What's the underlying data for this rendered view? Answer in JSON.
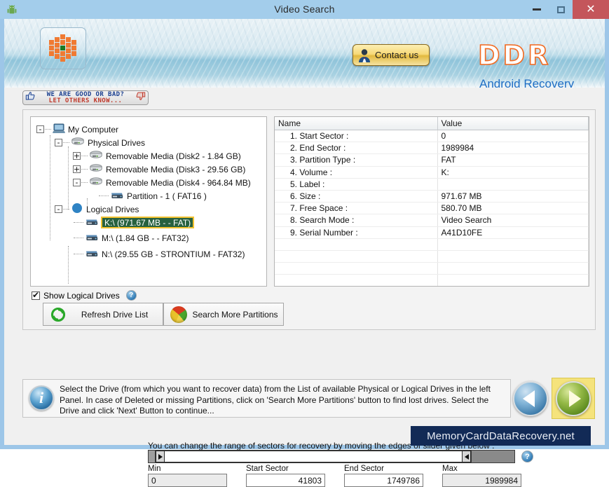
{
  "window": {
    "title": "Video Search",
    "icon": "android-robot-icon",
    "buttons": {
      "minimize": "minimize",
      "maximize": "maximize",
      "close": "✕"
    }
  },
  "header": {
    "app_icon": "checkered-flower-icon",
    "contact_label": "Contact us",
    "contact_icon": "person-avatar-icon",
    "brand": "DDR",
    "brand_sub": "Android Recovery",
    "brand_color": "#f26a21",
    "brand_sub_color": "#1f6ec4"
  },
  "review_ribbon": {
    "line1": "WE ARE GOOD OR BAD?",
    "line2": "LET OTHERS KNOW...",
    "thumb_up_icon": "thumbs-up-icon",
    "thumb_down_icon": "thumbs-down-icon",
    "line1_color": "#1a3f8f",
    "line2_color": "#c0392b"
  },
  "tree": {
    "nodes": [
      {
        "label": "My Computer",
        "indent": 0,
        "toggle": "-",
        "icon": "computer-icon"
      },
      {
        "label": "Physical Drives",
        "indent": 1,
        "toggle": "-",
        "icon": "disk-stack-icon"
      },
      {
        "label": "Removable Media (Disk2 - 1.84 GB)",
        "indent": 2,
        "toggle": "+",
        "icon": "disk-stack-icon"
      },
      {
        "label": "Removable Media (Disk3 - 29.56 GB)",
        "indent": 2,
        "toggle": "+",
        "icon": "disk-stack-icon"
      },
      {
        "label": "Removable Media (Disk4 - 964.84 MB)",
        "indent": 2,
        "toggle": "-",
        "icon": "disk-stack-icon"
      },
      {
        "label": "Partition - 1 ( FAT16 )",
        "indent": 3,
        "toggle": "",
        "icon": "drive-icon"
      },
      {
        "label": "Logical Drives",
        "indent": 1,
        "toggle": "-",
        "icon": "logical-drives-icon"
      },
      {
        "label": "K:\\ (971.67 MB -  - FAT)",
        "indent": 2,
        "toggle": "",
        "icon": "drive-icon",
        "selected": true
      },
      {
        "label": "M:\\ (1.84 GB -  - FAT32)",
        "indent": 2,
        "toggle": "",
        "icon": "drive-icon"
      },
      {
        "label": "N:\\ (29.55 GB - STRONTIUM - FAT32)",
        "indent": 2,
        "toggle": "",
        "icon": "drive-icon"
      }
    ],
    "selection_bg": "#27613f",
    "selection_border": "#f2c230"
  },
  "details_table": {
    "columns": [
      "Name",
      "Value"
    ],
    "rows": [
      {
        "name": "1. Start Sector :",
        "value": "0"
      },
      {
        "name": "2. End Sector :",
        "value": "1989984"
      },
      {
        "name": "3. Partition Type :",
        "value": "FAT"
      },
      {
        "name": "4. Volume :",
        "value": "K:"
      },
      {
        "name": "5. Label :",
        "value": ""
      },
      {
        "name": "6. Size :",
        "value": "971.67 MB"
      },
      {
        "name": "7. Free Space :",
        "value": "580.70 MB"
      },
      {
        "name": "8. Search Mode :",
        "value": "Video Search"
      },
      {
        "name": "9. Serial Number :",
        "value": "A41D10FE"
      },
      {
        "name": "",
        "value": ""
      },
      {
        "name": "",
        "value": ""
      },
      {
        "name": "",
        "value": ""
      },
      {
        "name": "",
        "value": ""
      }
    ]
  },
  "controls": {
    "show_logical_drives": "Show Logical Drives",
    "show_logical_checked": true,
    "help_glyph": "?",
    "refresh_label": "Refresh Drive List",
    "refresh_icon": "refresh-circular-arrows-icon",
    "search_partitions_label": "Search More Partitions",
    "search_partitions_icon": "pie-chart-icon"
  },
  "slider": {
    "hint": "You can change the range of sectors for recovery by moving the edges of slider given below :",
    "left_handle_icon": "slider-handle-right-arrow",
    "right_handle_icon": "slider-handle-left-arrow",
    "help_glyph": "?",
    "fields": [
      {
        "label": "Min",
        "value": "0"
      },
      {
        "label": "Start Sector",
        "value": "41803"
      },
      {
        "label": "End Sector",
        "value": "1749786"
      },
      {
        "label": "Max",
        "value": "1989984"
      }
    ]
  },
  "info": {
    "icon": "info-icon",
    "glyph": "i",
    "text": "Select the Drive (from which you want to recover data) from the List of available Physical or Logical Drives in the left Panel. In case of Deleted or missing Partitions, click on 'Search More Partitions' button to find lost drives. Select the Drive and click 'Next' Button to continue..."
  },
  "navigation": {
    "back_icon": "previous-arrow-icon",
    "next_icon": "next-arrow-icon",
    "next_highlight_color": "#f5e37c"
  },
  "watermark": {
    "text": "MemoryCardDataRecovery.net"
  }
}
